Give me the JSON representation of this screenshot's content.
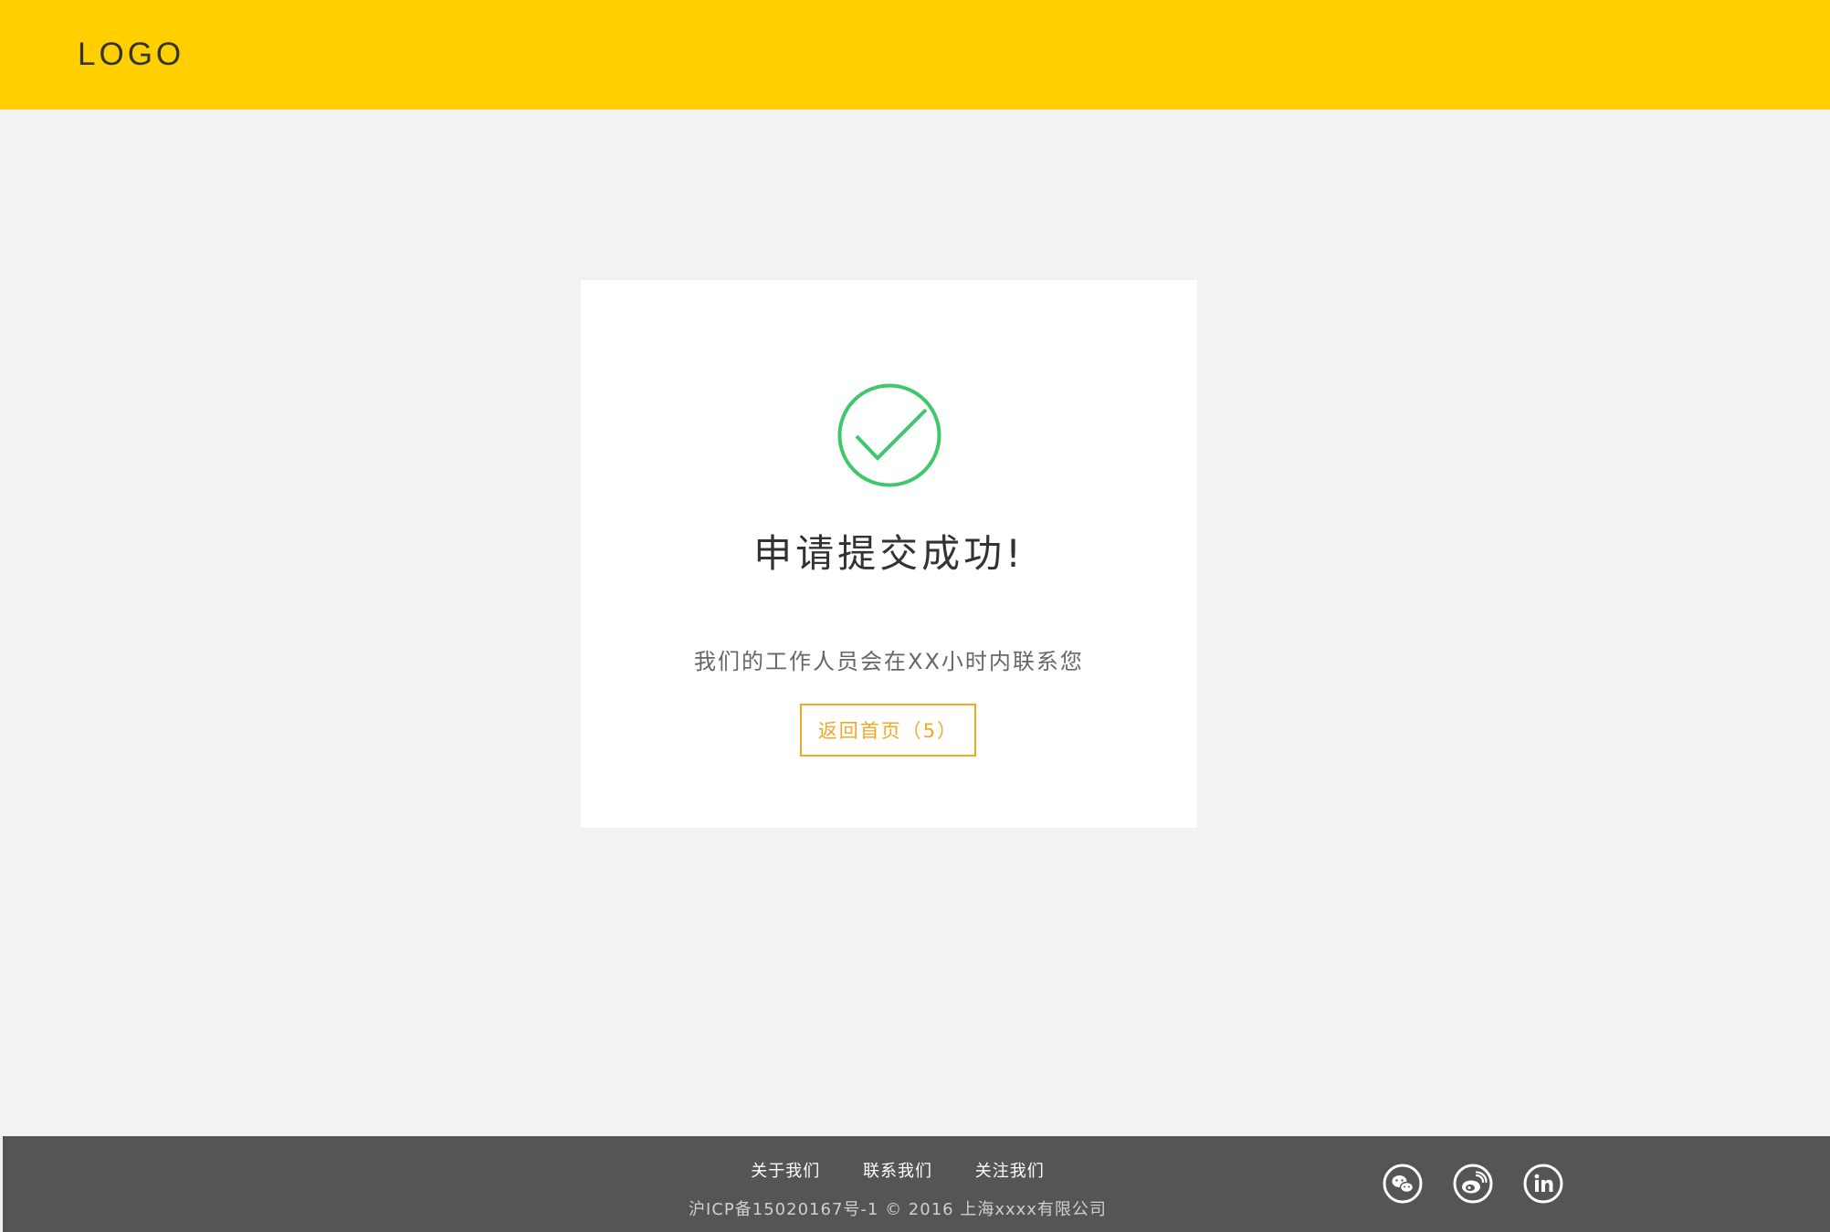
{
  "header": {
    "logo_text": "LOGO",
    "background_color": "#ffcf00"
  },
  "result": {
    "status_icon": "check-circle-icon",
    "title": "申请提交成功!",
    "message": "我们的工作人员会在XX小时内联系您",
    "home_button_label": "返回首页（5）",
    "success_color": "#3ec86b",
    "accent_color": "#f5a623"
  },
  "footer": {
    "links": [
      {
        "label": "关于我们"
      },
      {
        "label": "联系我们"
      },
      {
        "label": "关注我们"
      }
    ],
    "copyright": "沪ICP备15020167号-1 © 2016 上海xxxx有限公司",
    "social_icons": [
      "wechat-icon",
      "weibo-icon",
      "linkedin-icon"
    ],
    "background_color": "#555555"
  }
}
